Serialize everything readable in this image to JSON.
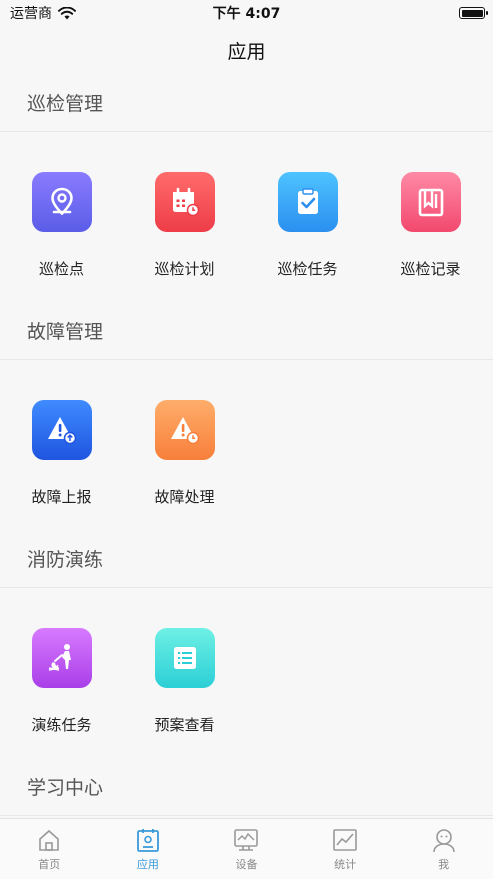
{
  "status_bar": {
    "carrier": "运营商",
    "time": "下午 4:07"
  },
  "nav": {
    "title": "应用"
  },
  "sections": [
    {
      "title": "巡检管理",
      "items": [
        {
          "label": "巡检点",
          "icon": "location-pin-icon",
          "gradient": [
            "#8a7bff",
            "#5a5de8"
          ]
        },
        {
          "label": "巡检计划",
          "icon": "calendar-clock-icon",
          "gradient": [
            "#ff6b6b",
            "#ee3d48"
          ]
        },
        {
          "label": "巡检任务",
          "icon": "clipboard-check-icon",
          "gradient": [
            "#4ec3ff",
            "#2b8ff0"
          ]
        },
        {
          "label": "巡检记录",
          "icon": "record-book-icon",
          "gradient": [
            "#ff8aa6",
            "#f2486e"
          ]
        }
      ]
    },
    {
      "title": "故障管理",
      "items": [
        {
          "label": "故障上报",
          "icon": "warning-upload-icon",
          "gradient": [
            "#3f8bff",
            "#1f55e0"
          ]
        },
        {
          "label": "故障处理",
          "icon": "warning-clock-icon",
          "gradient": [
            "#ffad6b",
            "#f77f3a"
          ]
        }
      ]
    },
    {
      "title": "消防演练",
      "items": [
        {
          "label": "演练任务",
          "icon": "fire-drill-icon",
          "gradient": [
            "#d77bff",
            "#a93ee8"
          ]
        },
        {
          "label": "预案查看",
          "icon": "plan-document-icon",
          "gradient": [
            "#6ef0e4",
            "#2bcfd6"
          ]
        }
      ]
    },
    {
      "title": "学习中心",
      "items": []
    }
  ],
  "tabs": [
    {
      "label": "首页",
      "icon": "home-icon",
      "active": false
    },
    {
      "label": "应用",
      "icon": "apps-icon",
      "active": true
    },
    {
      "label": "设备",
      "icon": "device-icon",
      "active": false
    },
    {
      "label": "统计",
      "icon": "chart-icon",
      "active": false
    },
    {
      "label": "我",
      "icon": "user-icon",
      "active": false
    }
  ],
  "colors": {
    "accent": "#3a9ad9",
    "inactive": "#888888"
  }
}
